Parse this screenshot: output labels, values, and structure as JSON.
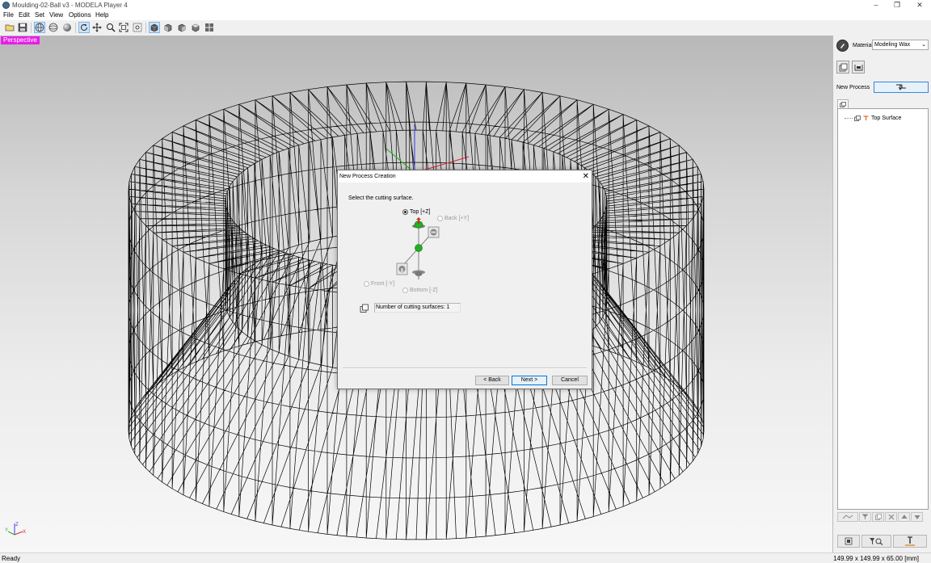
{
  "window": {
    "title": "Moulding-02-Ball v3 - MODELA Player 4",
    "controls": [
      "–",
      "❐",
      "✕"
    ]
  },
  "menu": [
    "File",
    "Edit",
    "Set",
    "View",
    "Options",
    "Help"
  ],
  "toolbar": {
    "buttons": [
      {
        "icon": "open-folder-icon",
        "active": false
      },
      {
        "icon": "save-icon",
        "active": false
      },
      {
        "icon": "wireframe-view-icon",
        "active": true
      },
      {
        "icon": "sphere-outline-icon",
        "active": false
      },
      {
        "icon": "shaded-sphere-icon",
        "active": false
      },
      {
        "icon": "rotate-icon",
        "active": true
      },
      {
        "icon": "pan-icon",
        "active": false
      },
      {
        "icon": "zoom-icon",
        "active": false
      },
      {
        "icon": "fit-view-icon",
        "active": false
      },
      {
        "icon": "zoom-window-icon",
        "active": false
      },
      {
        "icon": "perspective-cube-icon",
        "active": true
      },
      {
        "icon": "cube-front-icon",
        "active": false
      },
      {
        "icon": "cube-side-icon",
        "active": false
      },
      {
        "icon": "cube-top-icon",
        "active": false
      },
      {
        "icon": "four-views-icon",
        "active": false
      }
    ]
  },
  "viewport": {
    "mode_label": "Perspective",
    "axis_labels": {
      "x": "X",
      "y": "Y",
      "z": "Z"
    }
  },
  "right_panel": {
    "material_label": "Material",
    "material_value": "Modeling Wax",
    "new_process_label": "New Process",
    "tree_items": [
      {
        "label": "Top Surface"
      }
    ]
  },
  "dialog": {
    "title": "New Process Creation",
    "prompt": "Select the cutting surface.",
    "options": {
      "top": "Top [+Z]",
      "back": "Back [+Y]",
      "front": "Front [-Y]",
      "bottom": "Bottom [-Z]"
    },
    "selected": "top",
    "count_text": "Number of cutting surfaces: 1",
    "buttons": {
      "back": "< Back",
      "next": "Next >",
      "cancel": "Cancel"
    }
  },
  "status": {
    "left": "Ready",
    "right": "149.99 x 149.99 x 65.00 [mm]"
  },
  "colors": {
    "perspective_label_bg": "#e61ee6",
    "default_button_border": "#0078d7"
  }
}
